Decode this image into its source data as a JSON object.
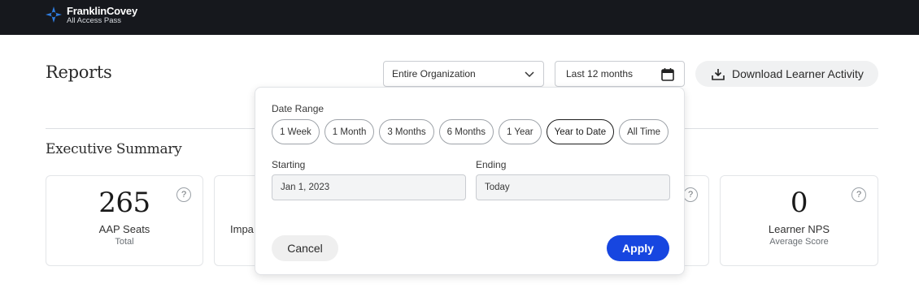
{
  "brand": {
    "name": "FranklinCovey",
    "subtitle": "All Access Pass"
  },
  "header": {
    "title": "Reports",
    "org_select": {
      "value": "Entire Organization",
      "icon": "chevron-down-icon"
    },
    "date_field": {
      "value": "Last 12 months",
      "icon": "calendar-icon"
    },
    "download_button": {
      "label": "Download Learner Activity",
      "icon": "download-icon"
    }
  },
  "section": {
    "title": "Executive Summary"
  },
  "cards": [
    {
      "value": "265",
      "label": "AAP Seats",
      "sub": "Total",
      "help": "?"
    },
    {
      "value": "",
      "label": "Impa",
      "sub": "",
      "help": ""
    },
    {
      "value": "",
      "label": "",
      "sub": "",
      "help": "?"
    },
    {
      "value": "0",
      "label": "Learner NPS",
      "sub": "Average Score",
      "help": "?"
    }
  ],
  "date_popover": {
    "range_label": "Date Range",
    "chips": [
      "1 Week",
      "1 Month",
      "3 Months",
      "6 Months",
      "1 Year",
      "Year to Date",
      "All Time"
    ],
    "selected_chip": "Year to Date",
    "starting_label": "Starting",
    "starting_value": "Jan 1, 2023",
    "ending_label": "Ending",
    "ending_value": "Today",
    "cancel_label": "Cancel",
    "apply_label": "Apply"
  },
  "colors": {
    "topbar": "#16181d",
    "accent": "#1746e0"
  }
}
